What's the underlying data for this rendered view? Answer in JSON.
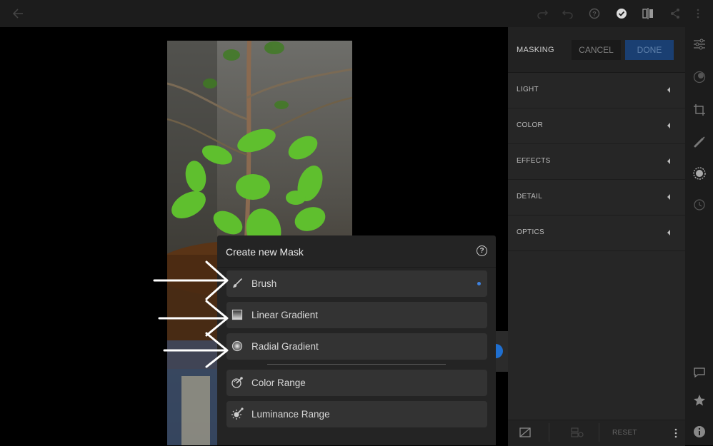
{
  "panel": {
    "title": "MASKING",
    "cancel_label": "CANCEL",
    "done_label": "DONE",
    "sections": [
      "LIGHT",
      "COLOR",
      "EFFECTS",
      "DETAIL",
      "OPTICS"
    ],
    "reset_label": "RESET"
  },
  "dialog": {
    "title": "Create new Mask",
    "options": [
      "Brush",
      "Linear Gradient",
      "Radial Gradient",
      "Color Range",
      "Luminance Range"
    ],
    "selected_indicator_color": "#3f83e0"
  },
  "colors": {
    "accent": "#1a3f72",
    "panel_bg": "#262626",
    "topbar_bg": "#1c1c1c"
  }
}
